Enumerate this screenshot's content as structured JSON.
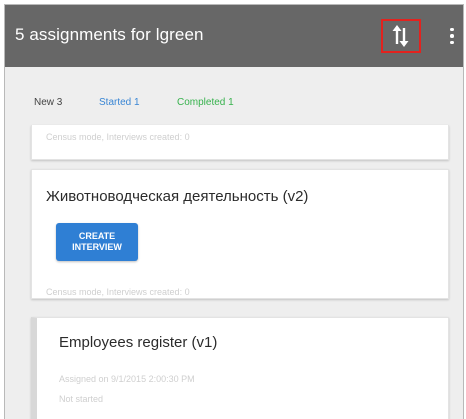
{
  "appbar": {
    "title": "5 assignments for lgreen",
    "sync_icon": "sync-arrows-icon",
    "menu_icon": "more-vert-icon"
  },
  "tabs": {
    "new": "New 3",
    "started": "Started 1",
    "completed": "Completed 1"
  },
  "cards": [
    {
      "meta": "Census mode, Interviews created: 0"
    },
    {
      "title": "Животноводческая деятельность (v2)",
      "button_line1": "CREATE",
      "button_line2": "INTERVIEW",
      "meta": "Census mode, Interviews created: 0"
    },
    {
      "title": "Employees register (v1)",
      "assigned": "Assigned on 9/1/2015 2:00:30 PM",
      "status": "Not started"
    }
  ],
  "colors": {
    "appbar": "#676767",
    "highlight": "#e3221e",
    "started": "#3a86d4",
    "completed": "#37b24d",
    "button": "#2f7fd4"
  }
}
